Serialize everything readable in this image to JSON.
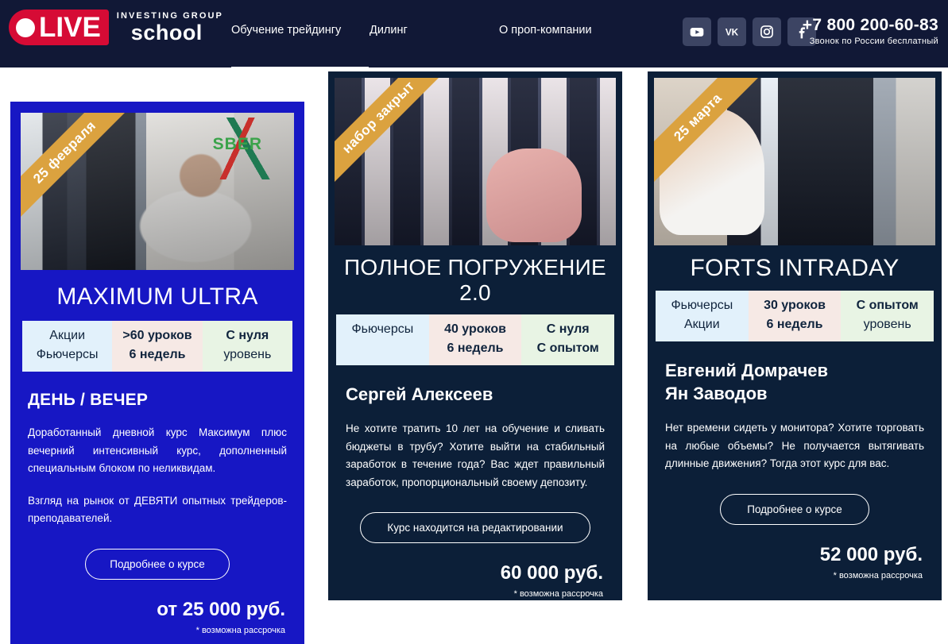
{
  "header": {
    "logo": {
      "badge_text": "LIVE",
      "tagline": "INVESTING GROUP",
      "name": "school"
    },
    "nav": [
      {
        "label": "Обучение трейдингу",
        "active": true
      },
      {
        "label": "Дилинг",
        "active": false
      },
      {
        "label": "О проп-компании",
        "active": false
      }
    ],
    "socials": [
      {
        "name": "youtube-icon",
        "label": "YouTube"
      },
      {
        "name": "vk-icon",
        "label": "VK"
      },
      {
        "name": "instagram-icon",
        "label": "Instagram"
      },
      {
        "name": "facebook-icon",
        "label": "Facebook"
      }
    ],
    "phone": "+7 800 200-60-83",
    "phone_note": "Звонок по России бесплатный"
  },
  "cards": [
    {
      "ribbon": "25 февраля",
      "title": "MAXIMUM ULTRA",
      "photo_label": "SBER",
      "specs": [
        {
          "line1": "Акции",
          "line2": "Фьючерсы",
          "bold1": false,
          "bold2": false
        },
        {
          "line1": ">60 уроков",
          "line2": "6 недель",
          "bold1": true,
          "bold2": true
        },
        {
          "line1": "С нуля",
          "line2": "уровень",
          "bold1": true,
          "bold2": false
        }
      ],
      "subtitle": "ДЕНЬ / ВЕЧЕР",
      "paragraphs": [
        "Доработанный дневной курс Максимум плюс вечерний интенсивный курс, дополненный специальным блоком по неликвидам.",
        "Взгляд на рынок от ДЕВЯТИ опытных трейдеров-преподавателей."
      ],
      "cta": "Подробнее о курсе",
      "price": "от 25 000 руб.",
      "installment": "* возможна рассрочка"
    },
    {
      "ribbon": "набор закрыт",
      "title": "ПОЛНОЕ ПОГРУЖЕНИЕ 2.0",
      "specs": [
        {
          "line1": "Фьючерсы",
          "line2": "",
          "bold1": false,
          "bold2": false
        },
        {
          "line1": "40 уроков",
          "line2": "6 недель",
          "bold1": true,
          "bold2": true
        },
        {
          "line1": "С нуля",
          "line2": "С опытом",
          "bold1": true,
          "bold2": true
        }
      ],
      "teacher": "Сергей Алексеев",
      "paragraphs": [
        "Не хотите тратить 10 лет на обучение и сливать бюджеты в трубу? Хотите выйти на стабильный заработок в течение года? Вас ждет правильный заработок, пропорциональный своему депозиту."
      ],
      "cta": "Курс находится на редактировании",
      "price": "60 000 руб.",
      "installment": "* возможна рассрочка"
    },
    {
      "ribbon": "25 марта",
      "title": "FORTS INTRADAY",
      "specs": [
        {
          "line1": "Фьючерсы",
          "line2": "Акции",
          "bold1": false,
          "bold2": false
        },
        {
          "line1": "30 уроков",
          "line2": "6 недель",
          "bold1": true,
          "bold2": true
        },
        {
          "line1": "С опытом",
          "line2": "уровень",
          "bold1": true,
          "bold2": false
        }
      ],
      "teacher": "Евгений Домрачев\nЯн Заводов",
      "teacher_line1": "Евгений Домрачев",
      "teacher_line2": "Ян Заводов",
      "paragraphs": [
        "Нет времени сидеть у монитора? Хотите торговать на любые объемы? Не получается вытягивать длинные движения? Тогда этот курс для вас."
      ],
      "cta": "Подробнее о курсе",
      "price": "52 000 руб.",
      "installment": "* возможна рассрочка"
    }
  ],
  "colors": {
    "header_bg": "#111836",
    "logo_red": "#d60b35",
    "card_blue": "#1717c4",
    "card_navy": "#0c1f38",
    "ribbon_gold": "#dba23f",
    "spec_blue": "#e2f1fb",
    "spec_pink": "#f6e9e5",
    "spec_green": "#e8f4e4"
  }
}
